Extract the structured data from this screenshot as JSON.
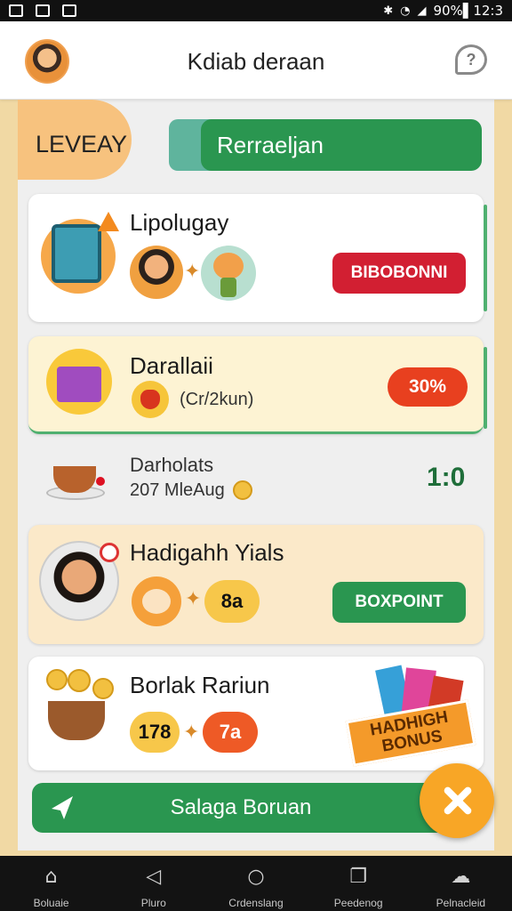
{
  "status_bar": {
    "battery_and_time": "90%▌12:3"
  },
  "header": {
    "title": "Kdiab deraan"
  },
  "level": {
    "label": "LEVEAY"
  },
  "tabs": {
    "primary_label": "Rerraeljan"
  },
  "cards": [
    {
      "title": "Lipolugay",
      "button": "BIBOBONNI"
    },
    {
      "title": "Darallaii",
      "subtitle": "(Cr/2kun)",
      "badge": "30%"
    },
    {
      "title": "Darholats",
      "subtitle": "207 MleAug",
      "score": "1:0"
    },
    {
      "title": "Hadigahh Yials",
      "pill": "8a",
      "button": "BOXPOINT"
    },
    {
      "title": "Borlak Rariun",
      "pill_a": "178",
      "pill_b": "7a",
      "promo": "HADHIGH BONUS"
    }
  ],
  "bottom_button": {
    "label": "Salaga Boruan"
  },
  "nav": [
    {
      "label": "Boluaie",
      "icon": "home-icon"
    },
    {
      "label": "Pluro",
      "icon": "back-triangle-icon"
    },
    {
      "label": "Crdenslang",
      "icon": "search-icon"
    },
    {
      "label": "Peedenog",
      "icon": "recents-icon"
    },
    {
      "label": "Pelnacleid",
      "icon": "profile-icon"
    }
  ],
  "colors": {
    "green": "#2a9650",
    "red": "#d21f32",
    "orange": "#f8a626",
    "cream": "#fdf3d3"
  }
}
